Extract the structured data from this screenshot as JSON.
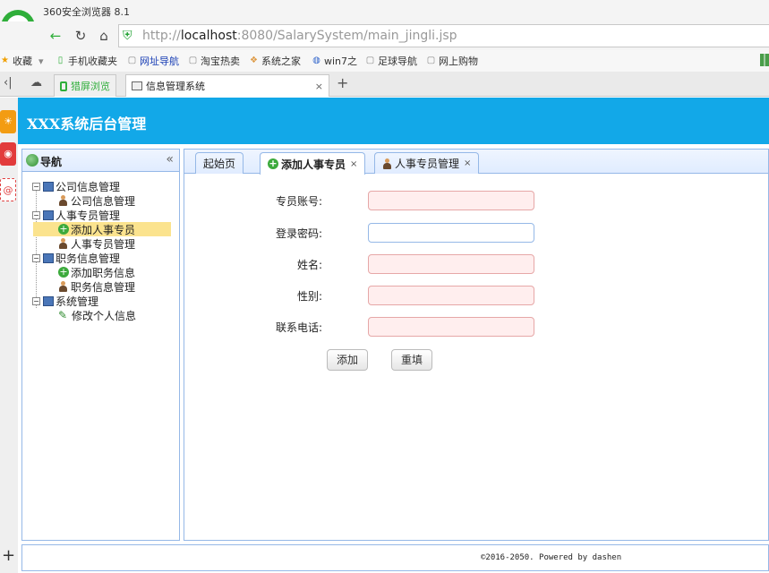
{
  "browser": {
    "window_title": "360安全浏览器 8.1",
    "url_prefix": "http://",
    "url_host": "localhost",
    "url_rest": ":8080/SalarySystem/main_jingli.jsp",
    "bookmarks": [
      "收藏",
      "手机收藏夹",
      "网址导航",
      "淘宝热卖",
      "系统之家",
      "win7之",
      "足球导航",
      "网上购物"
    ],
    "tabs": [
      {
        "label": "猎屏浏览"
      },
      {
        "label": "信息管理系统",
        "close": "×"
      }
    ],
    "new_tab": "+"
  },
  "app": {
    "title": "XXX系统后台管理",
    "nav_title": "导航",
    "nav_collapse": "«",
    "tree": [
      {
        "label": "公司信息管理",
        "children": [
          "公司信息管理"
        ]
      },
      {
        "label": "人事专员管理",
        "children": [
          "添加人事专员",
          "人事专员管理"
        ]
      },
      {
        "label": "职务信息管理",
        "children": [
          "添加职务信息",
          "职务信息管理"
        ]
      },
      {
        "label": "系统管理",
        "children": [
          "修改个人信息"
        ]
      }
    ],
    "content_tabs": [
      {
        "label": "起始页"
      },
      {
        "label": "添加人事专员",
        "close": "×"
      },
      {
        "label": "人事专员管理",
        "close": "×"
      }
    ],
    "form": {
      "fields": [
        {
          "label": "专员账号:",
          "value": ""
        },
        {
          "label": "登录密码:",
          "value": ""
        },
        {
          "label": "姓名:",
          "value": ""
        },
        {
          "label": "性别:",
          "value": ""
        },
        {
          "label": "联系电话:",
          "value": ""
        }
      ],
      "add_button": "添加",
      "reset_button": "重填"
    },
    "footer": "©2016-2050. Powered by dashen"
  },
  "colors": {
    "header_bg": "#12a8e8",
    "panel_border": "#95b8e7",
    "selected_bg": "#fbe38e",
    "required_input_bg": "#ffeeee"
  }
}
